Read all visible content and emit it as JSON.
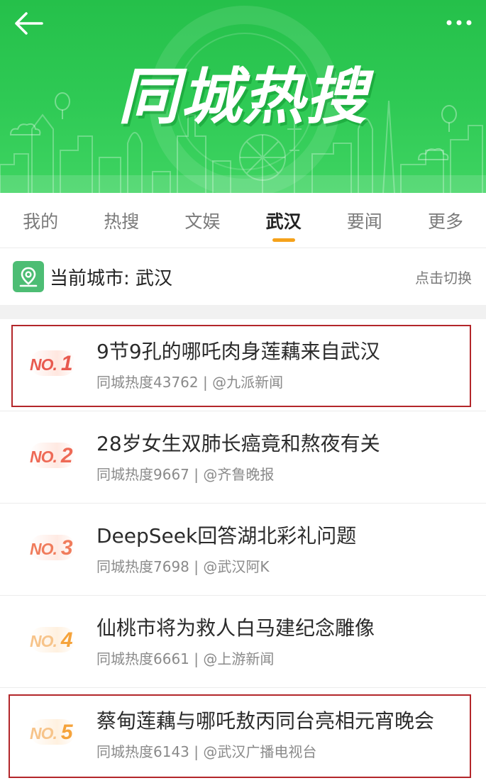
{
  "header": {
    "title": "同城热搜",
    "back_icon": "arrow-left-icon",
    "more_icon": "more-dots-icon"
  },
  "tabs": [
    {
      "label": "我的",
      "active": false
    },
    {
      "label": "热搜",
      "active": false
    },
    {
      "label": "文娱",
      "active": false
    },
    {
      "label": "武汉",
      "active": true
    },
    {
      "label": "要闻",
      "active": false
    },
    {
      "label": "更多",
      "active": false
    }
  ],
  "city": {
    "label": "当前城市: 武汉",
    "switch_label": "点击切换",
    "icon": "map-pin-icon"
  },
  "items": [
    {
      "rank_prefix": "NO.",
      "rank": "1",
      "title": "9节9孔的哪吒肉身莲藕来自武汉",
      "meta": "同城热度43762 | @九派新闻",
      "color": "#e85a4f",
      "highlighted": true
    },
    {
      "rank_prefix": "NO.",
      "rank": "2",
      "title": "28岁女生双肺长癌竟和熬夜有关",
      "meta": "同城热度9667 | @齐鲁晚报",
      "color": "#ee6a56",
      "highlighted": false
    },
    {
      "rank_prefix": "NO.",
      "rank": "3",
      "title": "DeepSeek回答湖北彩礼问题",
      "meta": "同城热度7698 | @武汉阿K",
      "color": "#f07c5c",
      "highlighted": false
    },
    {
      "rank_prefix": "NO.",
      "rank": "4",
      "title": "仙桃市将为救人白马建纪念雕像",
      "meta": "同城热度6661 | @上游新闻",
      "color": "#f5a33b",
      "highlighted": false
    },
    {
      "rank_prefix": "NO.",
      "rank": "5",
      "title": "蔡甸莲藕与哪吒敖丙同台亮相元宵晚会",
      "meta": "同城热度6143 | @武汉广播电视台",
      "color": "#f5a33b",
      "highlighted": true
    }
  ],
  "colors": {
    "banner_green": "#2fca55",
    "tab_indicator": "#f5a21b",
    "highlight_border": "#b3262a"
  }
}
